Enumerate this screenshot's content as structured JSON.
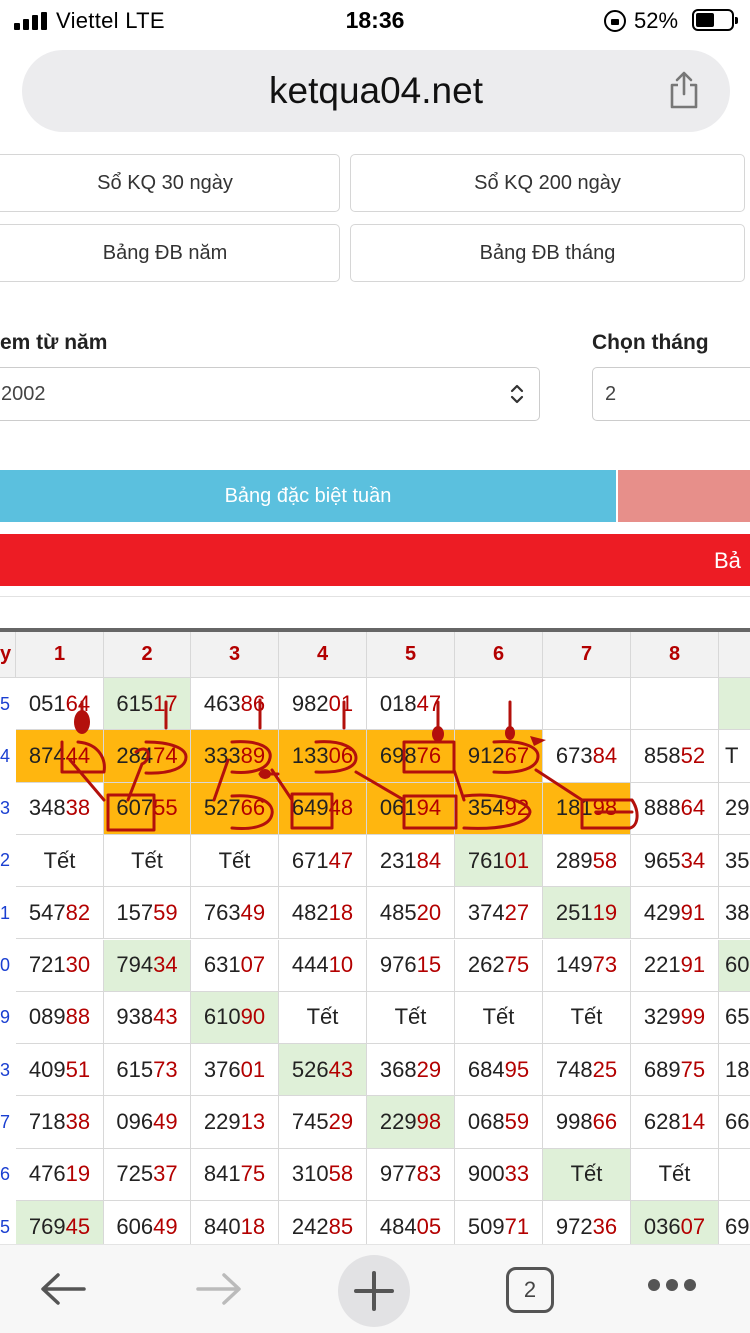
{
  "status_bar": {
    "carrier": "Viettel  LTE",
    "time": "18:36",
    "battery": "52%"
  },
  "browser": {
    "url": "ketqua04.net",
    "tab_count": "2"
  },
  "buttons": {
    "so_kq_30": "Sổ KQ 30 ngày",
    "so_kq_200": "Sổ KQ 200 ngày",
    "bang_db_nam": "Bảng ĐB năm",
    "bang_db_thang": "Bảng ĐB tháng"
  },
  "filters": {
    "year_label": "em từ năm",
    "year_value": "2002",
    "month_label": "Chọn tháng",
    "month_value": "2"
  },
  "bars": {
    "weekly": "Bảng đặc biệt tuần",
    "red_partial": "Bả"
  },
  "table": {
    "corner": "y",
    "headers": [
      "1",
      "2",
      "3",
      "4",
      "5",
      "6",
      "7",
      "8"
    ],
    "row_labels": [
      "5",
      "4",
      "3",
      "2",
      "1",
      "0",
      "9",
      "3",
      "7",
      "6",
      "5"
    ],
    "rows": [
      [
        {
          "h": "051",
          "t": "64"
        },
        {
          "h": "615",
          "t": "17"
        },
        {
          "h": "463",
          "t": "86"
        },
        {
          "h": "982",
          "t": "01"
        },
        {
          "h": "018",
          "t": "47"
        },
        {
          "h": "",
          "t": ""
        },
        {
          "h": "",
          "t": ""
        },
        {
          "h": "",
          "t": ""
        },
        {
          "h": "",
          "t": ""
        }
      ],
      [
        {
          "h": "874",
          "t": "44"
        },
        {
          "h": "284",
          "t": "74"
        },
        {
          "h": "333",
          "t": "89"
        },
        {
          "h": "133",
          "t": "06"
        },
        {
          "h": "698",
          "t": "76"
        },
        {
          "h": "912",
          "t": "67"
        },
        {
          "h": "673",
          "t": "84"
        },
        {
          "h": "858",
          "t": "52"
        },
        {
          "h": "T",
          "t": ""
        }
      ],
      [
        {
          "h": "348",
          "t": "38"
        },
        {
          "h": "607",
          "t": "55"
        },
        {
          "h": "527",
          "t": "66"
        },
        {
          "h": "649",
          "t": "48"
        },
        {
          "h": "061",
          "t": "94"
        },
        {
          "h": "354",
          "t": "92"
        },
        {
          "h": "181",
          "t": "98"
        },
        {
          "h": "888",
          "t": "64"
        },
        {
          "h": "29",
          "t": ""
        }
      ],
      [
        {
          "h": "Tết",
          "t": ""
        },
        {
          "h": "Tết",
          "t": ""
        },
        {
          "h": "Tết",
          "t": ""
        },
        {
          "h": "671",
          "t": "47"
        },
        {
          "h": "231",
          "t": "84"
        },
        {
          "h": "761",
          "t": "01"
        },
        {
          "h": "289",
          "t": "58"
        },
        {
          "h": "965",
          "t": "34"
        },
        {
          "h": "35",
          "t": ""
        }
      ],
      [
        {
          "h": "547",
          "t": "82"
        },
        {
          "h": "157",
          "t": "59"
        },
        {
          "h": "763",
          "t": "49"
        },
        {
          "h": "482",
          "t": "18"
        },
        {
          "h": "485",
          "t": "20"
        },
        {
          "h": "374",
          "t": "27"
        },
        {
          "h": "251",
          "t": "19"
        },
        {
          "h": "429",
          "t": "91"
        },
        {
          "h": "38",
          "t": ""
        }
      ],
      [
        {
          "h": "721",
          "t": "30"
        },
        {
          "h": "794",
          "t": "34"
        },
        {
          "h": "631",
          "t": "07"
        },
        {
          "h": "444",
          "t": "10"
        },
        {
          "h": "976",
          "t": "15"
        },
        {
          "h": "262",
          "t": "75"
        },
        {
          "h": "149",
          "t": "73"
        },
        {
          "h": "221",
          "t": "91"
        },
        {
          "h": "60",
          "t": ""
        }
      ],
      [
        {
          "h": "089",
          "t": "88"
        },
        {
          "h": "938",
          "t": "43"
        },
        {
          "h": "610",
          "t": "90"
        },
        {
          "h": "Tết",
          "t": ""
        },
        {
          "h": "Tết",
          "t": ""
        },
        {
          "h": "Tết",
          "t": ""
        },
        {
          "h": "Tết",
          "t": ""
        },
        {
          "h": "329",
          "t": "99"
        },
        {
          "h": "65",
          "t": ""
        }
      ],
      [
        {
          "h": "409",
          "t": "51"
        },
        {
          "h": "615",
          "t": "73"
        },
        {
          "h": "376",
          "t": "01"
        },
        {
          "h": "526",
          "t": "43"
        },
        {
          "h": "368",
          "t": "29"
        },
        {
          "h": "684",
          "t": "95"
        },
        {
          "h": "748",
          "t": "25"
        },
        {
          "h": "689",
          "t": "75"
        },
        {
          "h": "18",
          "t": ""
        }
      ],
      [
        {
          "h": "718",
          "t": "38"
        },
        {
          "h": "096",
          "t": "49"
        },
        {
          "h": "229",
          "t": "13"
        },
        {
          "h": "745",
          "t": "29"
        },
        {
          "h": "229",
          "t": "98"
        },
        {
          "h": "068",
          "t": "59"
        },
        {
          "h": "998",
          "t": "66"
        },
        {
          "h": "628",
          "t": "14"
        },
        {
          "h": "66",
          "t": ""
        }
      ],
      [
        {
          "h": "476",
          "t": "19"
        },
        {
          "h": "725",
          "t": "37"
        },
        {
          "h": "841",
          "t": "75"
        },
        {
          "h": "310",
          "t": "58"
        },
        {
          "h": "977",
          "t": "83"
        },
        {
          "h": "900",
          "t": "33"
        },
        {
          "h": "Tết",
          "t": ""
        },
        {
          "h": "Tết",
          "t": ""
        },
        {
          "h": "",
          "t": ""
        }
      ],
      [
        {
          "h": "769",
          "t": "45"
        },
        {
          "h": "606",
          "t": "49"
        },
        {
          "h": "840",
          "t": "18"
        },
        {
          "h": "242",
          "t": "85"
        },
        {
          "h": "484",
          "t": "05"
        },
        {
          "h": "509",
          "t": "71"
        },
        {
          "h": "972",
          "t": "36"
        },
        {
          "h": "036",
          "t": "07"
        },
        {
          "h": "69",
          "t": ""
        }
      ]
    ],
    "highlight_colors": {
      "green": "#dff0d8",
      "orange": "#ffb60f",
      "tail_red": "#b30000",
      "ink": "#b3100c"
    }
  },
  "icons": {
    "share": "share-icon",
    "back": "back-arrow-icon",
    "forward": "forward-arrow-icon",
    "new_tab": "plus-icon",
    "more": "more-dots-icon"
  }
}
